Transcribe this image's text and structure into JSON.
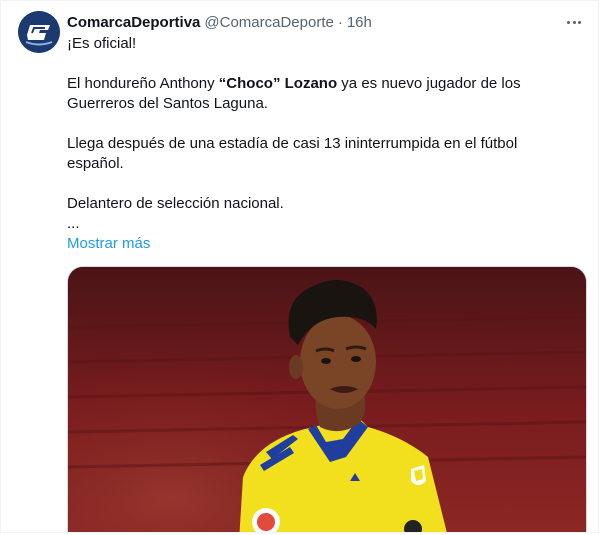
{
  "tweet": {
    "display_name": "ComarcaDeportiva",
    "handle": "@ComarcaDeporte",
    "separator": "·",
    "time": "16h",
    "lines": {
      "l1": "¡Es oficial!",
      "l2_a": "El hondureño Anthony ",
      "l2_b": "“Choco”",
      "l2_c": " ",
      "l2_d": "Lozano",
      "l2_e": " ya es nuevo jugador de los",
      "l3": "Guerreros del Santos Laguna.",
      "l4": "Llega después de una estadía de casi 13 ininterrumpida en el fútbol",
      "l5": "español.",
      "l6": "Delantero de selección nacional.",
      "l7": "..."
    },
    "show_more": "Mostrar más"
  },
  "colors": {
    "link": "#1d9bf0",
    "secondary_text": "#536471",
    "avatar_bg": "#1d3a70",
    "jersey": "#f2e01f",
    "stadium": "#7a1c1e"
  },
  "icons": {
    "more": "more-dots-icon",
    "avatar": "comarca-logo-icon"
  }
}
